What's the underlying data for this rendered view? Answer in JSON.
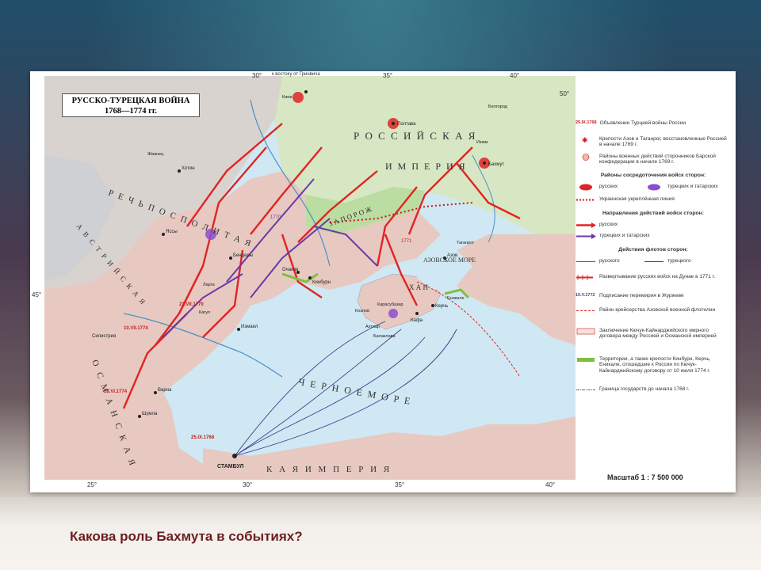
{
  "map": {
    "title_line1": "РУССКО-ТУРЕЦКАЯ ВОЙНА",
    "title_line2": "1768—1774 гг.",
    "coord_top": [
      "30°",
      "к востоку от Гринвича",
      "35°",
      "40°"
    ],
    "coord_bottom": [
      "25°",
      "30°",
      "35°",
      "40°"
    ],
    "coord_left": "45°",
    "coord_right": "50°",
    "regions": {
      "russia": "Р О С С И Й С К А Я",
      "empire": "И М П Е Р И Я",
      "rech": "Р Е Ч Ь   П О С П О Л И Т А Я",
      "austria": "А В С Т Р И Й С К А Я",
      "ottoman": "О С М А Н С К А Я",
      "ottoman2": "К А Я   И М П Е Р И Я",
      "black_sea": "Ч Е Р Н О Е   М О Р Е",
      "azov_sea": "АЗОВСКОЕ МОРЕ",
      "zaporozhie": "З А П О Р О Ж",
      "krym_h": "Х А Н"
    },
    "cities": [
      "Бахмут",
      "Полтава",
      "Азов",
      "Керчь",
      "Кафа",
      "Кинбурн",
      "Очаков",
      "Бендеры",
      "Хотин",
      "Яссы",
      "Измаил",
      "Варна",
      "Шумла",
      "Силистрия",
      "СТАМБУЛ",
      "Карасубазар",
      "Ахтиар",
      "Козлов",
      "Балаклава",
      "Еникале",
      "Таганрог",
      "Киев",
      "Жванец",
      "Кагул",
      "Ларга",
      "Белгород",
      "Изюм"
    ],
    "dates": [
      "25.IX.1768",
      "21.VII.1770",
      "10.VII.1774",
      "18.VI.1774",
      "1770",
      "1771"
    ]
  },
  "legend": {
    "items": [
      {
        "date": "25.IX.1768",
        "text": "Объявление Турцией войны России"
      },
      {
        "text": "Крепости Азов и Таганрог, восстановленные Россией в начале 1769 г."
      },
      {
        "text": "Районы военных действий сторонников Барской конфедерации в начале 1769 г."
      },
      {
        "heading": "Районы сосредоточения войск сторон:"
      },
      {
        "text": "русских",
        "text2": "турецких и татарских"
      },
      {
        "text": "Украинская укреплённая линия"
      },
      {
        "heading": "Направления действий войск сторон:"
      },
      {
        "text": "русских"
      },
      {
        "text": "турецких и татарских"
      },
      {
        "heading": "Действия флотов сторон:"
      },
      {
        "text": "русского",
        "text2": "турецкого"
      },
      {
        "text": "Развертывание русских войск на Дунае в 1771 г."
      },
      {
        "date": "10.V.1772",
        "text": "Подписание перемирия в Журжеве"
      },
      {
        "text": "Район крейсерства Азовской военной флотилии"
      },
      {
        "text": "Заключение Кючук-Кайнарджийского мирного договора между Россией и Османской империей"
      },
      {
        "text": "Территории, а также крепости Кинбурн, Керчь, Еникале, отошедшие к России по Кючук-Кайнарджийскому договору от 10 июля 1774 г."
      },
      {
        "text": "Граница государств до начала 1768 г."
      }
    ],
    "scale": "Масштаб 1 : 7 500 000"
  },
  "question": "Какова роль Бахмута в событиях?",
  "colors": {
    "russian": "#e02424",
    "turkish": "#6a3aa8",
    "land_russia": "#d7e6c3",
    "land_ottoman": "#e7c9c1",
    "land_poland": "#d8d3cf",
    "sea": "#cfe8f3",
    "ceded": "#7fbf3f"
  }
}
